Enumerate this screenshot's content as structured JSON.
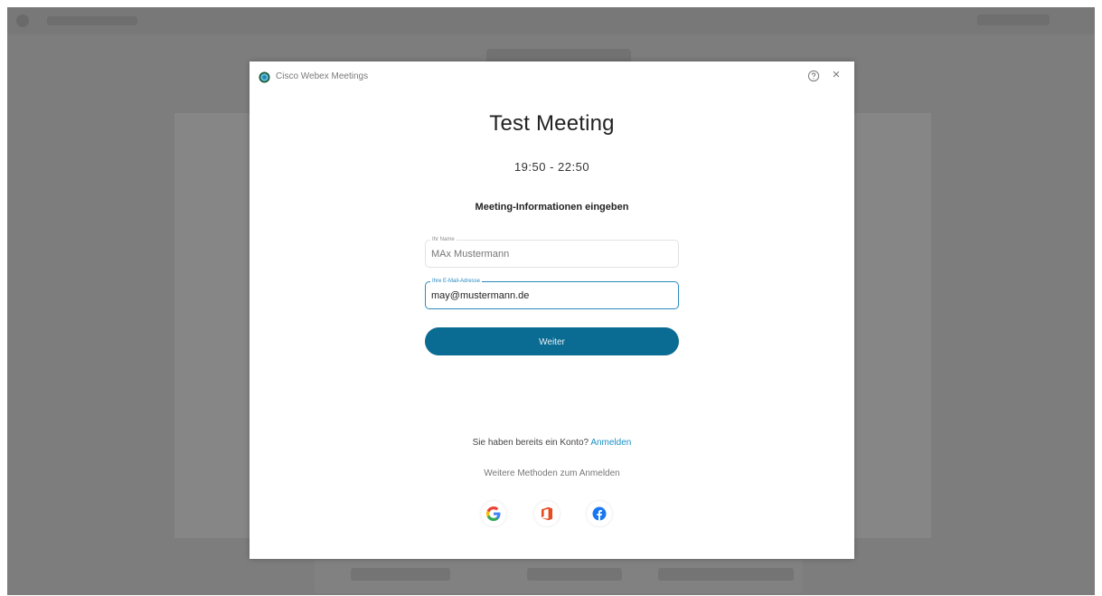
{
  "dialog": {
    "app_title": "Cisco Webex Meetings",
    "help_icon": "help-circle-icon",
    "close_icon": "close-icon",
    "close_glyph": "×"
  },
  "meeting": {
    "title": "Test Meeting",
    "time": "19:50 - 22:50"
  },
  "form": {
    "heading": "Meeting-Informationen eingeben",
    "name_label": "Ihr Name",
    "name_value": "MAx Mustermann",
    "email_label": "Ihre E-Mail-Adresse",
    "email_value": "may@mustermann.de",
    "next_label": "Weiter"
  },
  "signin": {
    "account_question": "Sie haben bereits ein Konto?",
    "signin_link": "Anmelden",
    "more_methods": "Weitere Methoden zum Anmelden",
    "providers": [
      "google-icon",
      "office-icon",
      "facebook-icon"
    ]
  },
  "colors": {
    "accent": "#0a6b93",
    "link": "#1a8fc4",
    "overlay": "#7d7d7d"
  }
}
